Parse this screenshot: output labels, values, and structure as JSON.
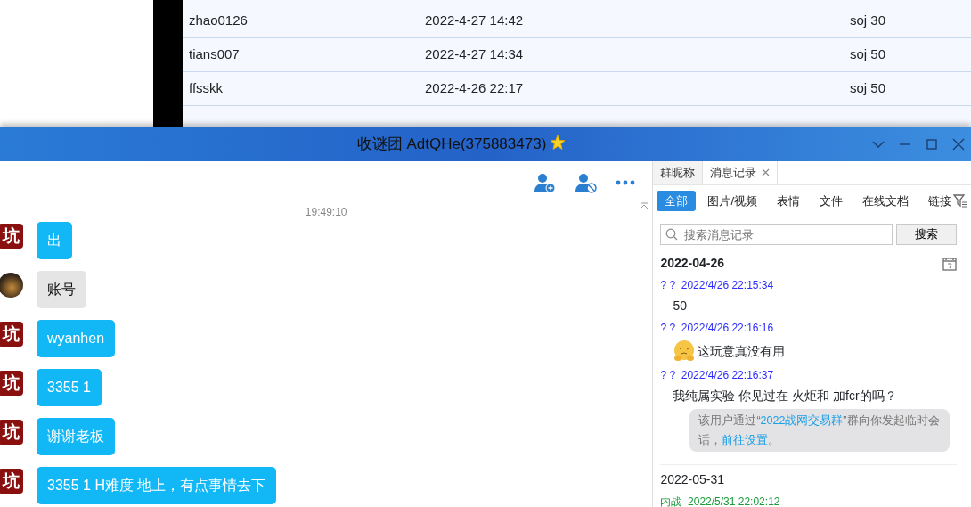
{
  "table_rows": [
    {
      "user": "zhao0126",
      "time": "2022-4-27 14:42",
      "item": "soj 30"
    },
    {
      "user": "tians007",
      "time": "2022-4-27 14:34",
      "item": "soj 50"
    },
    {
      "user": "ffsskk",
      "time": "2022-4-26 22:17",
      "item": "soj 50"
    }
  ],
  "chat_window": {
    "title": "收谜团 AdtQHe(375883473)",
    "timestamp": "19:49:10",
    "messages": [
      {
        "kind": "seal",
        "avatar_text": "坑",
        "text": "出"
      },
      {
        "kind": "photo",
        "text": "账号"
      },
      {
        "kind": "seal",
        "avatar_text": "坑",
        "text": "wyanhen"
      },
      {
        "kind": "seal",
        "avatar_text": "坑",
        "text": "3355 1"
      },
      {
        "kind": "seal",
        "avatar_text": "坑",
        "text": "谢谢老板"
      },
      {
        "kind": "seal",
        "avatar_text": "坑",
        "text": "3355 1 H难度 地上，有点事情去下"
      }
    ],
    "side_tabs": [
      {
        "label": "群昵称",
        "selected": false,
        "closable": false
      },
      {
        "label": "消息记录",
        "selected": true,
        "closable": true
      }
    ],
    "filters": [
      {
        "label": "全部",
        "selected": true
      },
      {
        "label": "图片/视频",
        "selected": false
      },
      {
        "label": "表情",
        "selected": false
      },
      {
        "label": "文件",
        "selected": false
      },
      {
        "label": "在线文档",
        "selected": false
      },
      {
        "label": "链接",
        "selected": false
      }
    ],
    "search": {
      "placeholder": "搜索消息记录",
      "button": "搜索"
    },
    "history": [
      {
        "date": "2022-04-26",
        "selected": true,
        "entries": [
          {
            "sender": "? ?",
            "time": "2022/4/26 22:15:34",
            "color": "#2b2bff",
            "emoji": false,
            "text": "50"
          },
          {
            "sender": "? ?",
            "time": "2022/4/26 22:16:16",
            "color": "#2b2bff",
            "emoji": true,
            "text": "这玩意真没有用"
          },
          {
            "sender": "? ?",
            "time": "2022/4/26 22:16:37",
            "color": "#2b2bff",
            "emoji": false,
            "text": "我纯属实验 你见过在  火炬和 加fcr的吗？",
            "notice": [
              {
                "text": "该用户通过“",
                "link": false
              },
              {
                "text": "2022战网交易群",
                "link": true
              },
              {
                "text": "”群向你发起临时会话，",
                "link": false
              },
              {
                "text": "前往设置",
                "link": true
              },
              {
                "text": "。",
                "link": false
              }
            ]
          }
        ]
      },
      {
        "date": "2022-05-31",
        "selected": false,
        "entries": [
          {
            "sender": "内战",
            "time": "2022/5/31 22:02:12",
            "color": "#1a9a3a",
            "emoji": false
          }
        ]
      }
    ]
  }
}
